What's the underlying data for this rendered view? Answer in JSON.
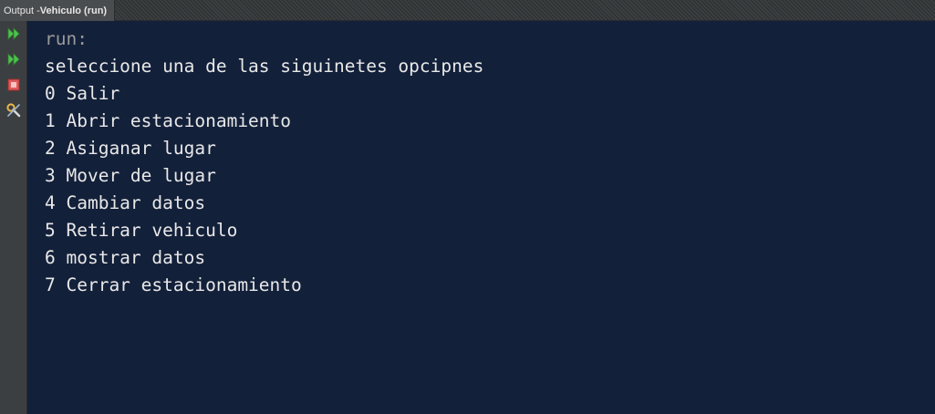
{
  "window": {
    "tab_prefix": "Output - ",
    "tab_title": "Vehiculo (run)"
  },
  "toolbar": {
    "items": [
      {
        "icon": "rerun-icon"
      },
      {
        "icon": "rerun-with-options-icon"
      },
      {
        "icon": "stop-icon"
      },
      {
        "icon": "settings-tools-icon"
      }
    ]
  },
  "console": {
    "lines": [
      "run:",
      "seleccione una de las siguinetes opcipnes",
      "0 Salir",
      "1 Abrir estacionamiento",
      "2 Asiganar lugar",
      "3 Mover de lugar",
      "4 Cambiar datos",
      "5 Retirar vehiculo",
      "6 mostrar datos",
      "7 Cerrar estacionamiento"
    ]
  },
  "colors": {
    "console_background": "#13203a",
    "console_text": "#e8e8e8",
    "prompt_text": "#9a9a9a",
    "toolbar_background": "#3c3f41",
    "run_icon_green": "#4fc24f",
    "stop_icon_red": "#e05a5a"
  }
}
